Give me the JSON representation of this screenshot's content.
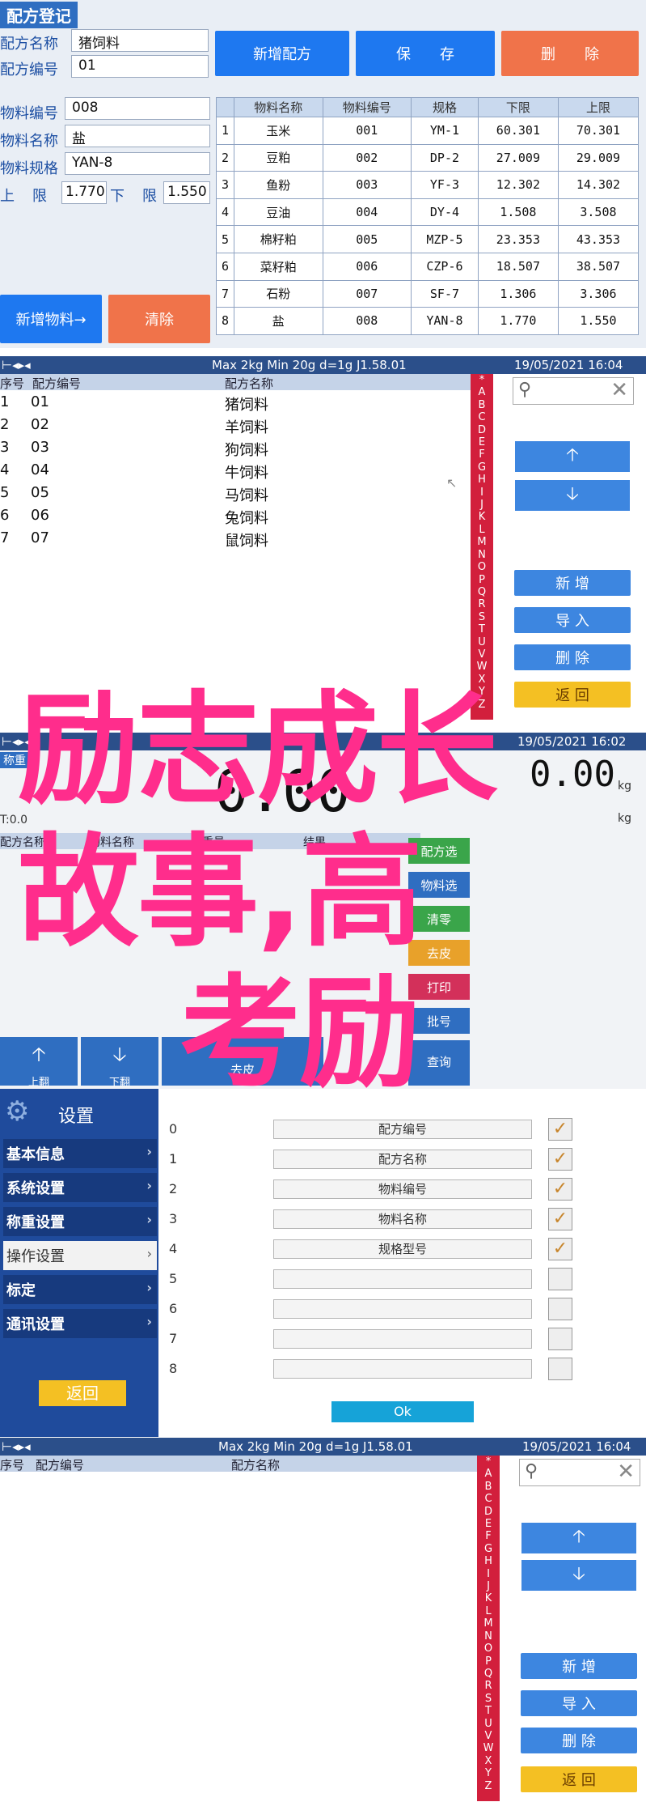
{
  "panel1": {
    "title": "配方登记",
    "recipe_name_label": "配方名称",
    "recipe_name_value": "猪饲料",
    "recipe_no_label": "配方编号",
    "recipe_no_value": "01",
    "material_no_label": "物料编号",
    "material_no_value": "008",
    "material_name_label": "物料名称",
    "material_name_value": "盐",
    "material_spec_label": "物料规格",
    "material_spec_value": "YAN-8",
    "upper_label": "上",
    "upper_label2": "限",
    "upper_value": "1.770",
    "lower_label": "下",
    "lower_label2": "限",
    "lower_value": "1.550",
    "btn_new_recipe": "新增配方",
    "btn_save": "保　　存",
    "btn_delete": "删　　除",
    "btn_new_material": "新增物料→",
    "btn_clear": "清除",
    "table": {
      "headers": [
        "",
        "物料名称",
        "物料编号",
        "规格",
        "下限",
        "上限"
      ],
      "rows": [
        [
          "1",
          "玉米",
          "001",
          "YM-1",
          "60.301",
          "70.301"
        ],
        [
          "2",
          "豆粕",
          "002",
          "DP-2",
          "27.009",
          "29.009"
        ],
        [
          "3",
          "鱼粉",
          "003",
          "YF-3",
          "12.302",
          "14.302"
        ],
        [
          "4",
          "豆油",
          "004",
          "DY-4",
          "1.508",
          "3.508"
        ],
        [
          "5",
          "棉籽粕",
          "005",
          "MZP-5",
          "23.353",
          "43.353"
        ],
        [
          "6",
          "菜籽粕",
          "006",
          "CZP-6",
          "18.507",
          "38.507"
        ],
        [
          "7",
          "石粉",
          "007",
          "SF-7",
          "1.306",
          "3.306"
        ],
        [
          "8",
          "盐",
          "008",
          "YAN-8",
          "1.770",
          "1.550"
        ]
      ]
    }
  },
  "panel2": {
    "status_spec": "Max 2kg  Min 20g  d=1g    J1.58.01",
    "date_time": "19/05/2021  16:04",
    "col_seq": "序号",
    "col_no": "配方编号",
    "col_name": "配方名称",
    "rows": [
      {
        "seq": "1",
        "no": "01",
        "name": "猪饲料"
      },
      {
        "seq": "2",
        "no": "02",
        "name": "羊饲料"
      },
      {
        "seq": "3",
        "no": "03",
        "name": "狗饲料"
      },
      {
        "seq": "4",
        "no": "04",
        "name": "牛饲料"
      },
      {
        "seq": "5",
        "no": "05",
        "name": "马饲料"
      },
      {
        "seq": "6",
        "no": "06",
        "name": "兔饲料"
      },
      {
        "seq": "7",
        "no": "07",
        "name": "鼠饲料"
      }
    ],
    "alphabet": [
      "*",
      "A",
      "B",
      "C",
      "D",
      "E",
      "F",
      "G",
      "H",
      "I",
      "J",
      "K",
      "L",
      "M",
      "N",
      "O",
      "P",
      "Q",
      "R",
      "S",
      "T",
      "U",
      "V",
      "W",
      "X",
      "Y",
      "Z"
    ],
    "btn_add": "新 增",
    "btn_import": "导 入",
    "btn_delete": "删 除",
    "btn_back": "返 回"
  },
  "panel3": {
    "date_time": "19/05/2021  16:02",
    "left_label": "称重",
    "zero_label": "T:0.0",
    "unit1": "kg",
    "unit2": "kg",
    "col_recipe": "配方名称",
    "col_material": "物料名称",
    "col_weight": "重量",
    "col_result": "结果",
    "digits_left": "0.00",
    "digits_right": "0.00",
    "tag1": "配方选",
    "tag2": "物料选",
    "tag3": "清零",
    "tag4": "去皮",
    "tag5": "打印",
    "tag6": "批号",
    "btn_up": "上翻",
    "btn_down": "下翻",
    "btn_mid": "去皮",
    "btn_query": "查询",
    "overlay_line1": "励志成长",
    "overlay_line2": "故事,高",
    "overlay_line3": "考励"
  },
  "panel4": {
    "title": "设置",
    "menu": [
      {
        "label": "基本信息",
        "active": false
      },
      {
        "label": "系统设置",
        "active": false
      },
      {
        "label": "称重设置",
        "active": false
      },
      {
        "label": "操作设置",
        "active": true
      },
      {
        "label": "标定",
        "active": false
      },
      {
        "label": "通讯设置",
        "active": false
      }
    ],
    "btn_back": "返回",
    "fields": [
      {
        "idx": "0",
        "label": "配方编号",
        "checked": true
      },
      {
        "idx": "1",
        "label": "配方名称",
        "checked": true
      },
      {
        "idx": "2",
        "label": "物料编号",
        "checked": true
      },
      {
        "idx": "3",
        "label": "物料名称",
        "checked": true
      },
      {
        "idx": "4",
        "label": "规格型号",
        "checked": true
      },
      {
        "idx": "5",
        "label": "",
        "checked": false
      },
      {
        "idx": "6",
        "label": "",
        "checked": false
      },
      {
        "idx": "7",
        "label": "",
        "checked": false
      },
      {
        "idx": "8",
        "label": "",
        "checked": false
      }
    ],
    "btn_ok": "Ok"
  },
  "panel5": {
    "status_spec": "Max 2kg  Min 20g  d=1g    J1.58.01",
    "date_time": "19/05/2021  16:04",
    "col_seq": "序号",
    "col_no": "配方编号",
    "col_name": "配方名称",
    "btn_add": "新 增",
    "btn_import": "导 入",
    "btn_delete": "删 除",
    "btn_back": "返 回"
  },
  "colors": {
    "accent_blue": "#1e78f0",
    "accent_orange": "#f0734a",
    "alpha_red": "#d21f3c",
    "overlay_pink": "#ff2d8c",
    "menu_blue": "#1f4b9c",
    "back_yellow": "#f4c023"
  }
}
